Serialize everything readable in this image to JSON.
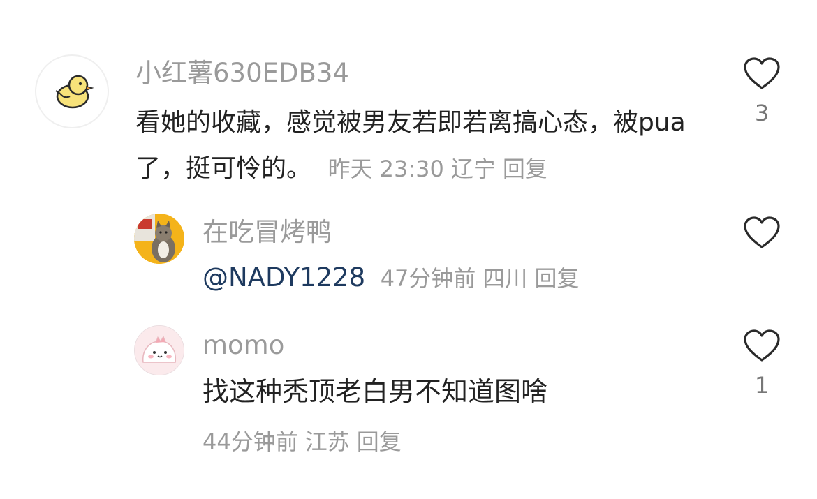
{
  "comments": [
    {
      "username": "小红薯630EDB34",
      "text": "看她的收藏，感觉被男友若即若离搞心态，被pua了，挺可怜的。",
      "time": "昨天 23:30",
      "location": "辽宁",
      "reply_label": "回复",
      "like_count": "3",
      "avatar_icon": "duck-avatar-icon"
    },
    {
      "username": "在吃冒烤鸭",
      "mention": "@NADY1228",
      "time": "47分钟前",
      "location": "四川",
      "reply_label": "回复",
      "like_count": "",
      "avatar_icon": "cat-photo-avatar"
    },
    {
      "username": "momo",
      "text": "找这种秃顶老白男不知道图啥",
      "time": "44分钟前",
      "location": "江苏",
      "reply_label": "回复",
      "like_count": "1",
      "avatar_icon": "pink-blob-avatar"
    }
  ],
  "colors": {
    "meta_gray": "#9a9a9a",
    "mention_blue": "#1e3a5f",
    "text_dark": "#222222"
  }
}
